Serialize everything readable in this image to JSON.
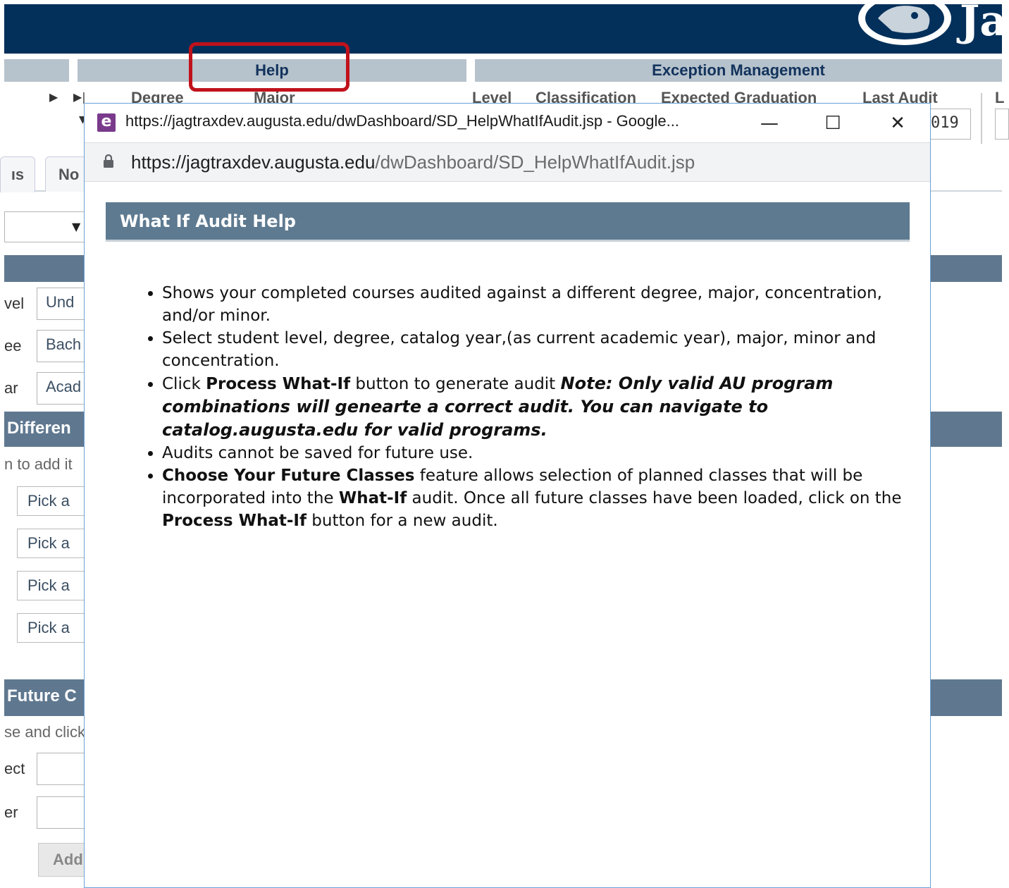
{
  "banner": {
    "logo_text": "Ja"
  },
  "nav": {
    "tabs": [
      {
        "label": ""
      },
      {
        "label": "Help"
      },
      {
        "label": "Exception Management"
      }
    ]
  },
  "student_header": {
    "labels": [
      "Degree",
      "Major",
      "Level",
      "Classification",
      "Expected Graduation",
      "Last Audit",
      "L"
    ],
    "last_audit_value": "019"
  },
  "side": {
    "tabs": [
      "ıs",
      "No"
    ],
    "rows": [
      {
        "label": "vel",
        "value": "Und"
      },
      {
        "label": "ee",
        "value": "Bach"
      },
      {
        "label": "ar",
        "value": "Acad"
      }
    ],
    "different_section": "Differen",
    "add_hint": "n to add it",
    "pick_buttons": [
      "Pick a",
      "Pick a",
      "Pick a",
      "Pick a"
    ],
    "future_section": "Future C",
    "future_hint": "se and click",
    "future_fields": [
      "ect",
      "er"
    ],
    "add_button": "Add"
  },
  "popup": {
    "title": "https://jagtraxdev.augusta.edu/dwDashboard/SD_HelpWhatIfAudit.jsp - Google...",
    "url_host": "https://jagtraxdev.augusta.edu",
    "url_path": "/dwDashboard/SD_HelpWhatIfAudit.jsp",
    "minimize": "—",
    "maximize": "☐",
    "close": "✕",
    "header": "What If Audit Help",
    "bullets": {
      "b1": "Shows your completed courses audited against a different degree, major, concentration, and/or minor.",
      "b2": "Select student level, degree, catalog year,(as current academic year), major, minor and concentration.",
      "b3_pre": "Click ",
      "b3_bold": "Process What-If",
      "b3_mid": " button to generate audit ",
      "b3_note": "Note: Only valid AU program combinations will genearte a correct audit. You can navigate to catalog.augusta.edu for valid programs.",
      "b4": "Audits cannot be saved for future use.",
      "b5_bold1": "Choose Your Future Classes",
      "b5_t1": " feature allows selection of planned classes that will be incorporated into the ",
      "b5_bold2": "What-If",
      "b5_t2": " audit. Once all future classes have been loaded, click on the ",
      "b5_bold3": "Process What-If",
      "b5_t3": " button for a new audit."
    }
  }
}
